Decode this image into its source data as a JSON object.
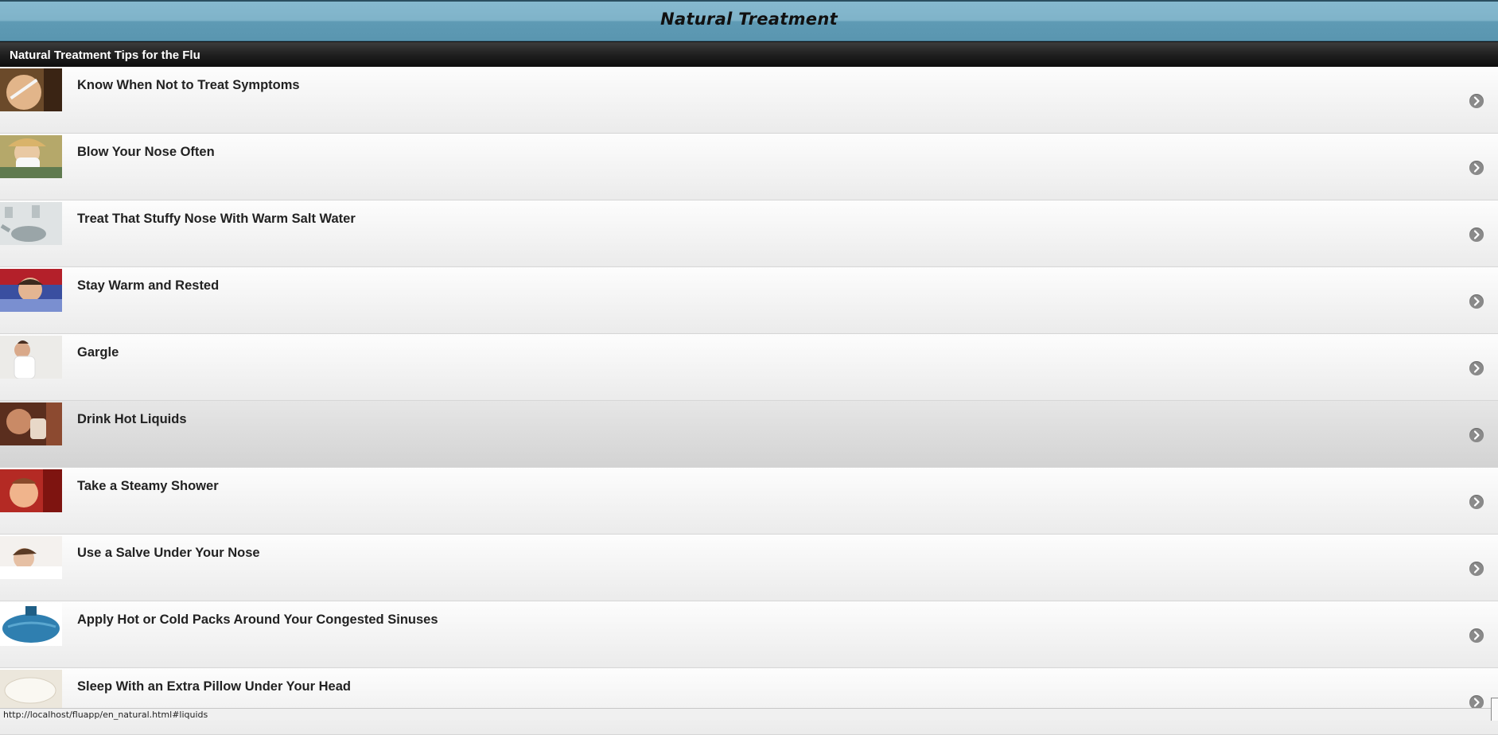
{
  "header": {
    "title": "Natural Treatment"
  },
  "section": {
    "title": "Natural Treatment Tips for the Flu"
  },
  "items": [
    {
      "label": "Know When Not to Treat Symptoms",
      "thumb": "thermometer-photo"
    },
    {
      "label": "Blow Your Nose Often",
      "thumb": "tissue-photo"
    },
    {
      "label": "Treat That Stuffy Nose With Warm Salt Water",
      "thumb": "neti-pot-photo"
    },
    {
      "label": "Stay Warm and Rested",
      "thumb": "resting-person-photo"
    },
    {
      "label": "Gargle",
      "thumb": "gargling-photo"
    },
    {
      "label": "Drink Hot Liquids",
      "thumb": "hot-drink-photo"
    },
    {
      "label": "Take a Steamy Shower",
      "thumb": "shower-photo"
    },
    {
      "label": "Use a Salve Under Your Nose",
      "thumb": "sleeping-person-photo"
    },
    {
      "label": "Apply Hot or Cold Packs Around Your Congested Sinuses",
      "thumb": "ice-pack-photo"
    },
    {
      "label": "Sleep With an Extra Pillow Under Your Head",
      "thumb": "pillow-photo"
    }
  ],
  "status": {
    "url": "http://localhost/fluapp/en_natural.html#liquids"
  },
  "icons": {
    "row_arrow": "chevron-right-circle-icon"
  },
  "colors": {
    "header_top": "#86b9cf",
    "header_bottom": "#5a96b0",
    "bar": "#1f1f1f"
  }
}
